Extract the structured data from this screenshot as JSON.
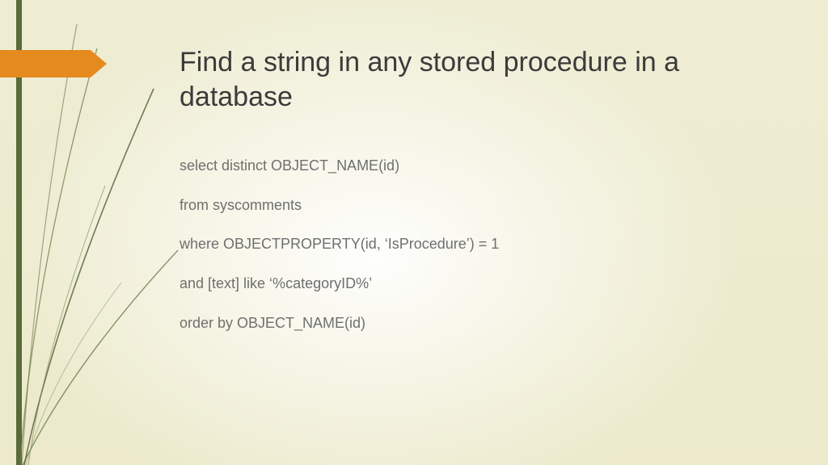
{
  "slide": {
    "title": "Find a string in any stored procedure in a database",
    "code_lines": [
      "select distinct OBJECT_NAME(id)",
      "from syscomments",
      "where OBJECTPROPERTY(id, ‘IsProcedure’) = 1",
      "and [text] like ‘%categoryID%’",
      "order by OBJECT_NAME(id)"
    ]
  },
  "theme": {
    "accent": "#e58a1f",
    "bar": "#5a6b3a",
    "bg_top": "#eeedd3",
    "bg_bottom": "#eceacb"
  }
}
